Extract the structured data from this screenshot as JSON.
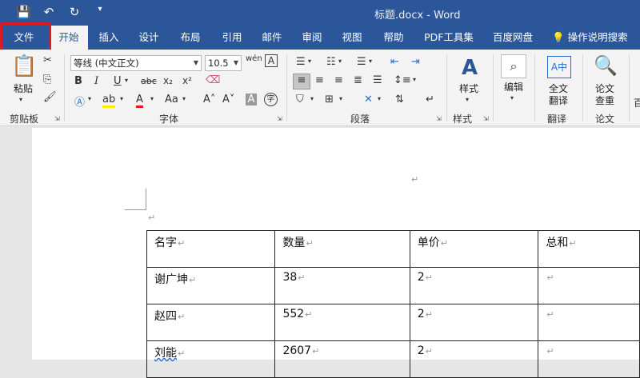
{
  "window": {
    "title": "标题.docx  -  Word"
  },
  "qat": {
    "save_icon": "save-icon",
    "undo_icon": "undo-icon",
    "redo_icon": "redo-icon",
    "customize_icon": "customize-qat-icon"
  },
  "tabs": [
    {
      "label": "文件"
    },
    {
      "label": "开始"
    },
    {
      "label": "插入"
    },
    {
      "label": "设计"
    },
    {
      "label": "布局"
    },
    {
      "label": "引用"
    },
    {
      "label": "邮件"
    },
    {
      "label": "审阅"
    },
    {
      "label": "视图"
    },
    {
      "label": "帮助"
    },
    {
      "label": "PDF工具集"
    },
    {
      "label": "百度网盘"
    }
  ],
  "tell_me": "操作说明搜索",
  "ribbon": {
    "clipboard": {
      "paste_label": "粘贴",
      "group_label": "剪贴板"
    },
    "font": {
      "font_name": "等线 (中文正文)",
      "font_size": "10.5",
      "group_label": "字体"
    },
    "paragraph": {
      "group_label": "段落"
    },
    "styles": {
      "label": "样式",
      "group_label": "样式"
    },
    "editing": {
      "label": "编辑"
    },
    "translate": {
      "label_line1": "全文",
      "label_line2": "翻译",
      "group_label": "翻译"
    },
    "paper": {
      "label_line1": "论文",
      "label_line2": "查重",
      "group_label": "论文"
    }
  },
  "table": {
    "headers": [
      "名字",
      "数量",
      "单价",
      "总和"
    ],
    "rows": [
      [
        "谢广坤",
        "38",
        "2",
        ""
      ],
      [
        "赵四",
        "552",
        "2",
        ""
      ],
      [
        "刘能",
        "2607",
        "2",
        ""
      ]
    ]
  },
  "paragraph_mark": "↵"
}
